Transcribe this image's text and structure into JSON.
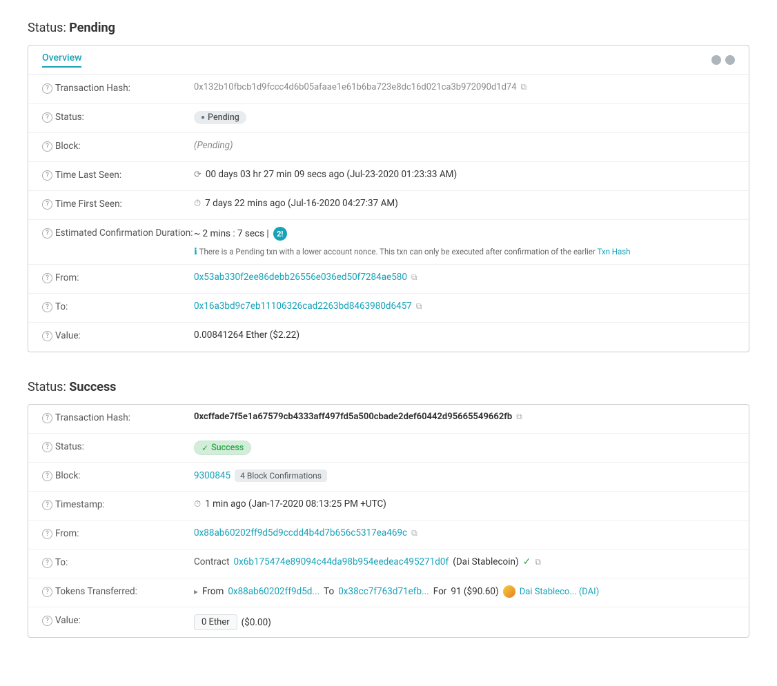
{
  "pending": {
    "section_title": "Status:",
    "section_status": "Pending",
    "tab_label": "Overview",
    "rows": {
      "tx_hash_label": "Transaction Hash:",
      "tx_hash_value": "0x132b10fbcb1d9fccc4d6b05afaae1e61b6ba723e8dc16d021ca3b972090d1d74",
      "status_label": "Status:",
      "status_value": "Pending",
      "block_label": "Block:",
      "block_value": "(Pending)",
      "time_last_seen_label": "Time Last Seen:",
      "time_last_seen_value": "00 days 03 hr 27 min 09 secs ago (Jul-23-2020 01:23:33 AM)",
      "time_first_seen_label": "Time First Seen:",
      "time_first_seen_value": "7 days 22 mins ago (Jul-16-2020 04:27:37 AM)",
      "est_conf_label": "Estimated Confirmation Duration:",
      "est_conf_value": "~ 2 mins : 7 secs |",
      "est_conf_note": "There is a Pending txn with a lower account nonce. This txn can only be executed after confirmation of the earlier",
      "est_conf_note_link": "Txn Hash",
      "from_label": "From:",
      "from_value": "0x53ab330f2ee86debb26556e036ed50f7284ae580",
      "to_label": "To:",
      "to_value": "0x16a3bd9c7eb11106326cad2263bd8463980d6457",
      "value_label": "Value:",
      "value_value": "0.00841264 Ether ($2.22)"
    }
  },
  "success": {
    "section_title": "Status:",
    "section_status": "Success",
    "rows": {
      "tx_hash_label": "Transaction Hash:",
      "tx_hash_value": "0xcffade7f5e1a67579cb4333aff497fd5a500cbade2def60442d95665549662fb",
      "status_label": "Status:",
      "status_value": "Success",
      "block_label": "Block:",
      "block_number": "9300845",
      "block_confirmations": "4 Block Confirmations",
      "timestamp_label": "Timestamp:",
      "timestamp_value": "1 min ago (Jan-17-2020 08:13:25 PM +UTC)",
      "from_label": "From:",
      "from_value": "0x88ab60202ff9d5d9ccdd4b4d7b656c5317ea469c",
      "to_label": "To:",
      "to_contract_label": "Contract",
      "to_contract_address": "0x6b175474e89094c44da98b954eedeac495271d0f",
      "to_contract_name": "(Dai Stablecoin)",
      "tokens_label": "Tokens Transferred:",
      "tokens_from_label": "From",
      "tokens_from_value": "0x88ab60202ff9d5d...",
      "tokens_to_label": "To",
      "tokens_to_value": "0x38cc7f763d71efb...",
      "tokens_for_label": "For",
      "tokens_amount": "91 ($90.60)",
      "tokens_name": "Dai Stableco... (DAI)",
      "value_label": "Value:",
      "value_box": "0 Ether",
      "value_usd": "($0.00)"
    }
  },
  "icons": {
    "question": "?",
    "copy": "⧉",
    "clock": "⏱",
    "spinner": "⟳",
    "check": "✓",
    "arrow": "▸",
    "info": "ℹ"
  }
}
